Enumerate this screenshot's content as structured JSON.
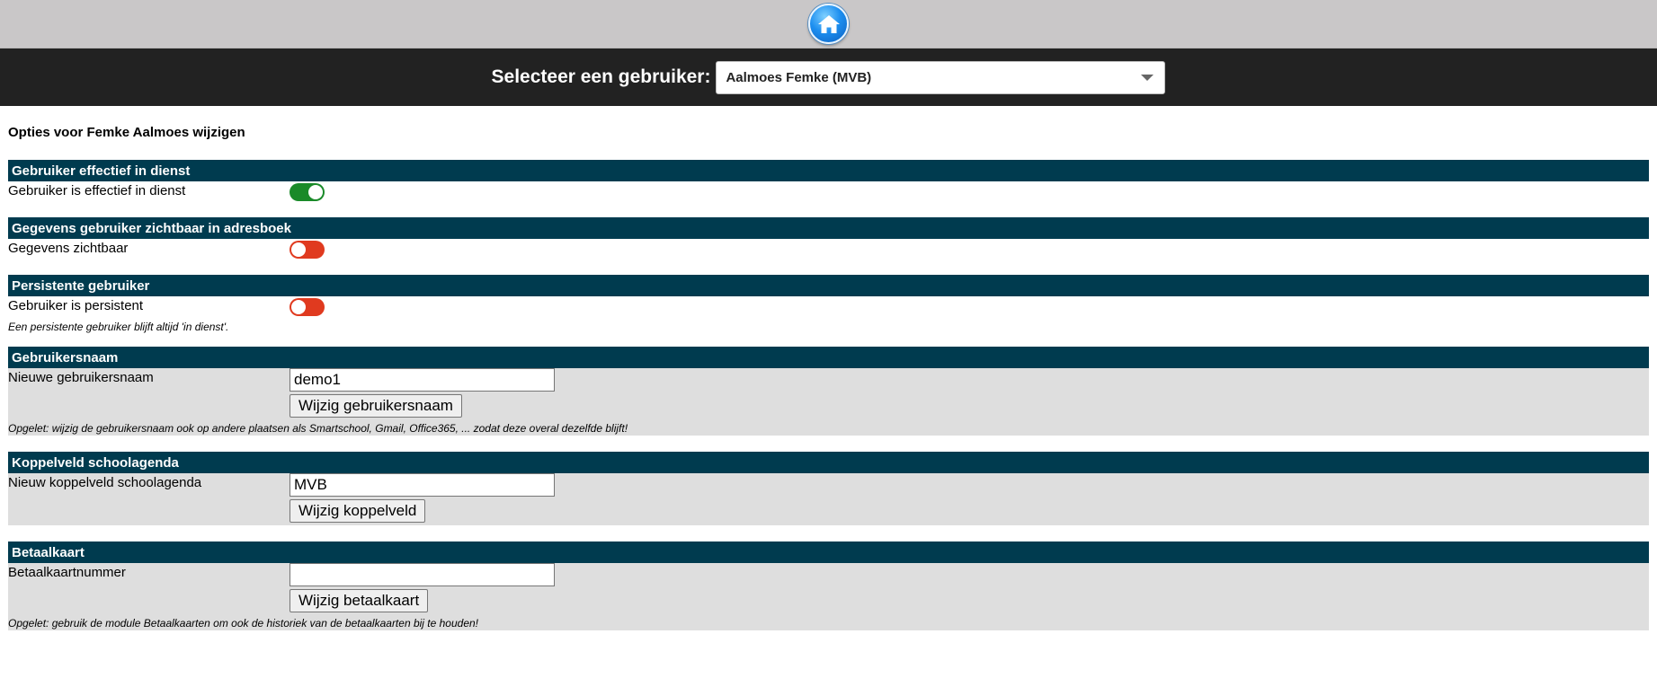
{
  "header": {
    "home_icon": "home-icon"
  },
  "userbar": {
    "label": "Selecteer een gebruiker:",
    "selected_user": "Aalmoes Femke (MVB)"
  },
  "page": {
    "title": "Opties voor Femke Aalmoes wijzigen"
  },
  "sections": {
    "effectief": {
      "header": "Gebruiker effectief in dienst",
      "label": "Gebruiker is effectief in dienst",
      "state": "on"
    },
    "zichtbaar": {
      "header": "Gegevens gebruiker zichtbaar in adresboek",
      "label": "Gegevens zichtbaar",
      "state": "off"
    },
    "persistent": {
      "header": "Persistente gebruiker",
      "label": "Gebruiker is persistent",
      "state": "off",
      "note": "Een persistente gebruiker blijft altijd 'in dienst'."
    },
    "gebruikersnaam": {
      "header": "Gebruikersnaam",
      "label": "Nieuwe gebruikersnaam",
      "value": "demo1",
      "button": "Wijzig gebruikersnaam",
      "note": "Opgelet: wijzig de gebruikersnaam ook op andere plaatsen als Smartschool, Gmail, Office365, ... zodat deze overal dezelfde blijft!"
    },
    "koppelveld": {
      "header": "Koppelveld schoolagenda",
      "label": "Nieuw koppelveld schoolagenda",
      "value": "MVB",
      "button": "Wijzig koppelveld"
    },
    "betaalkaart": {
      "header": "Betaalkaart",
      "label": "Betaalkaartnummer",
      "value": "",
      "button": "Wijzig betaalkaart",
      "note": "Opgelet: gebruik de module Betaalkaarten om ook de historiek van de betaalkaarten bij te houden!"
    }
  },
  "colors": {
    "section_header": "#003b4f",
    "toggle_on": "#1a8a29",
    "toggle_off": "#e03a1f",
    "userbar": "#222222",
    "topbar": "#c9c7c8"
  }
}
